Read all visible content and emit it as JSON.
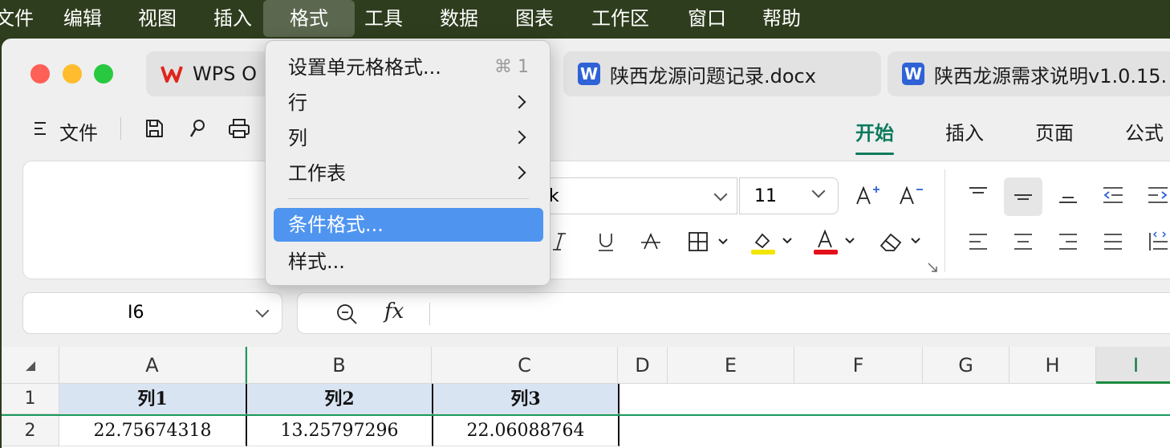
{
  "menubar": {
    "items": [
      "文件",
      "编辑",
      "视图",
      "插入",
      "格式",
      "工具",
      "数据",
      "图表",
      "工作区",
      "窗口",
      "帮助"
    ],
    "active": "格式"
  },
  "tabs": [
    {
      "icon": "wps-logo-icon",
      "label": "WPS O"
    },
    {
      "icon": "word-doc-icon",
      "label": "陕西龙源问题记录.docx"
    },
    {
      "icon": "word-doc-icon",
      "label": "陕西龙源需求说明v1.0.15."
    }
  ],
  "toolbar": {
    "file_label": "文件",
    "ribbon_tabs": [
      "开始",
      "插入",
      "页面",
      "公式"
    ],
    "active_tab": "开始"
  },
  "ribbon": {
    "font_name_partial": "k",
    "font_size": "11",
    "accent_colors": {
      "highlight": "#f2e600",
      "font_color": "#e3101b",
      "active_tab": "#0c7a5e"
    }
  },
  "formula_bar": {
    "cell_ref": "I6",
    "fx_label": "fx"
  },
  "grid": {
    "columns": [
      "A",
      "B",
      "C",
      "D",
      "E",
      "F",
      "G",
      "H",
      "I"
    ],
    "selected_column": "I",
    "row_numbers": [
      "1",
      "2"
    ],
    "header_row": [
      "列1",
      "列2",
      "列3"
    ],
    "data_row": [
      "22.75674318",
      "13.25797296",
      "22.06088764"
    ]
  },
  "format_menu": {
    "items": [
      {
        "label": "设置单元格格式...",
        "shortcut": "⌘ 1"
      },
      {
        "label": "行"
      },
      {
        "label": "列"
      },
      {
        "label": "工作表"
      },
      {
        "label": "条件格式..."
      },
      {
        "label": "样式..."
      }
    ],
    "highlighted": "条件格式..."
  }
}
